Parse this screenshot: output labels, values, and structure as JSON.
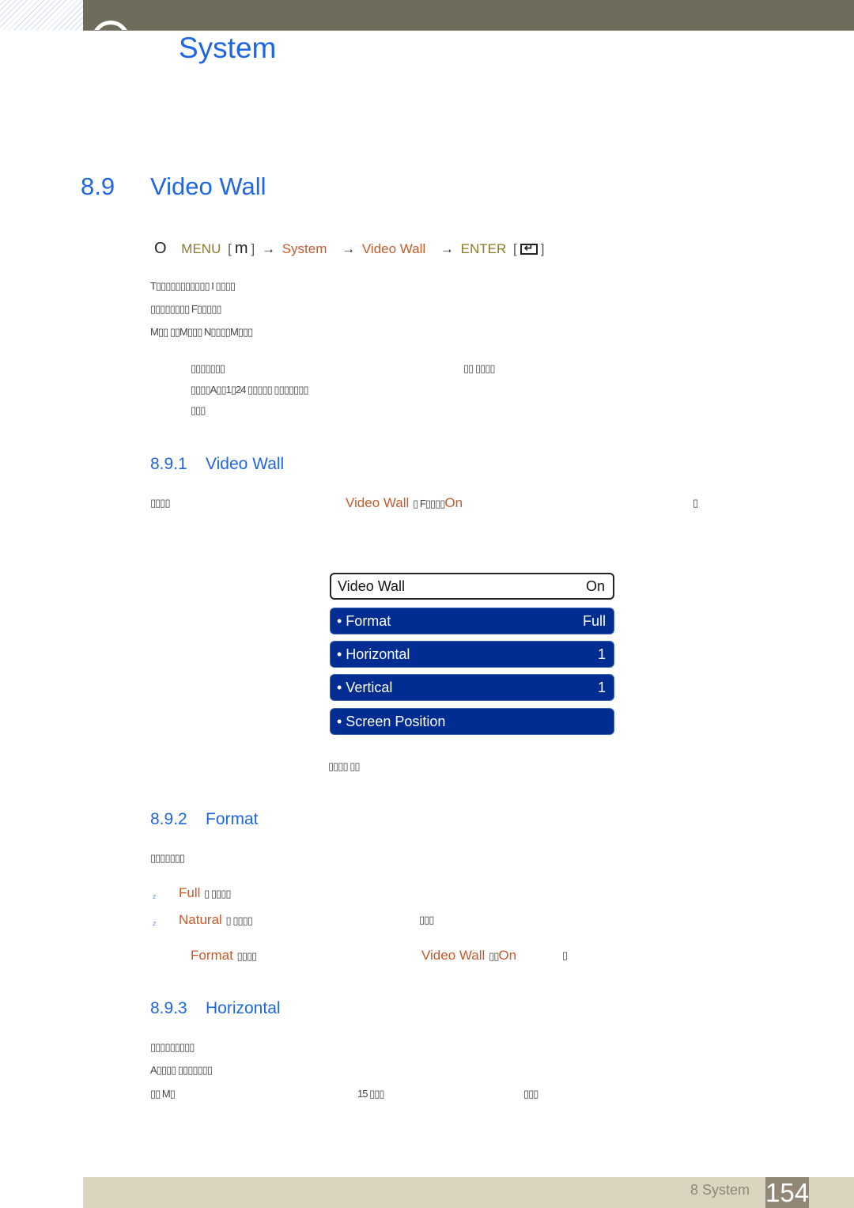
{
  "header": {
    "chapter_title": "System"
  },
  "section": {
    "number": "8.9",
    "title": "Video Wall"
  },
  "menu_path": {
    "prefix_icon": "O",
    "menu": "MENU",
    "menu_key": "m",
    "arrow": "→",
    "step1": "System",
    "step2": "Video Wall",
    "enter": "ENTER",
    "enter_icon": "enter-icon"
  },
  "intro_lines": [
    {
      "text": "T▯▯▯▯▯▯▯▯▯▯▯ I ▯▯▯▯"
    },
    {
      "text": "▯▯▯▯▯▯▯▯ F▯▯▯▯▯"
    },
    {
      "text": "M▯▯ ▯▯M▯▯▯ N▯▯▯▯M▯▯▯"
    }
  ],
  "note": {
    "line1_a": "▯▯▯▯▯▯▯",
    "line1_b": "▯▯ ▯▯▯▯",
    "line2": "▯▯▯▯A▯▯1▯24 ▯▯▯▯▯ ▯▯▯▯▯▯▯",
    "line3": "▯▯▯"
  },
  "sub1": {
    "number": "8.9.1",
    "title": "Video Wall",
    "desc_a": "▯▯▯▯",
    "desc_link": "Video Wall",
    "desc_b": "▯ F▯▯▯▯",
    "desc_value": "On",
    "desc_end": "▯"
  },
  "osd": {
    "header": {
      "label": "Video Wall",
      "value": "On"
    },
    "items": [
      {
        "label": "• Format",
        "value": "Full"
      },
      {
        "label": "• Horizontal",
        "value": "1"
      },
      {
        "label": "• Vertical",
        "value": "1"
      },
      {
        "label": "• Screen Position",
        "value": ""
      }
    ],
    "caption": "▯▯▯▯ ▯▯"
  },
  "sub2": {
    "number": "8.9.2",
    "title": "Format",
    "desc": "▯▯▯▯▯▯▯",
    "options": [
      {
        "bullet": "z",
        "name": "Full",
        "text": "▯ ▯▯▯▯",
        "extra": ""
      },
      {
        "bullet": "z",
        "name": "Natural",
        "text": "▯ ▯▯▯▯",
        "extra": "▯▯▯"
      }
    ],
    "note_a": "Format",
    "note_b": "▯▯▯▯",
    "note_link": "Video Wall",
    "note_c": "▯▯",
    "note_value": "On",
    "note_end": "▯"
  },
  "sub3": {
    "number": "8.9.3",
    "title": "Horizontal",
    "line1": "▯▯▯▯▯▯▯▯▯",
    "line2": "A▯▯▯▯ ▯▯▯▯▯▯▯",
    "line3_a": "▯▯ M▯",
    "line3_b": "15 ▯▯▯",
    "line3_c": "▯▯▯"
  },
  "footer": {
    "label": "8 System",
    "page": "154"
  },
  "colors": {
    "heading_blue": "#1f66e5",
    "link_orange": "#c85a2a",
    "menu_gold": "#8a7a2a",
    "osd_blue": "#012d92",
    "topbar": "#6e6c5a",
    "footer_bar": "#dbd4bf",
    "page_badge": "#928676"
  }
}
